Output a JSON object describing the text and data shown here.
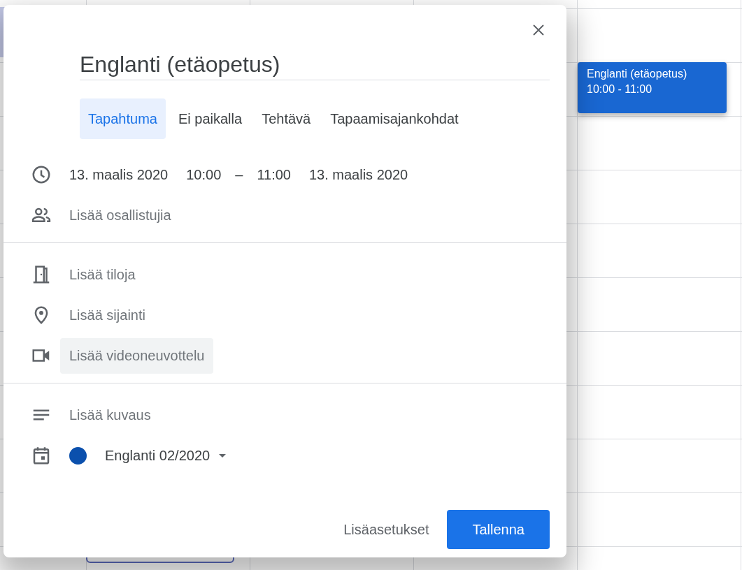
{
  "dialog": {
    "title": "Englanti (etäopetus)",
    "tabs": [
      {
        "label": "Tapahtuma",
        "selected": true
      },
      {
        "label": "Ei paikalla",
        "selected": false
      },
      {
        "label": "Tehtävä",
        "selected": false
      },
      {
        "label": "Tapaamisajankohdat",
        "selected": false
      }
    ],
    "date_time": {
      "start_date": "13. maalis 2020",
      "start_time": "10:00",
      "separator": "–",
      "end_time": "11:00",
      "end_date": "13. maalis 2020"
    },
    "sections": [
      [
        {
          "kind": "guests",
          "text": "Lisää osallistujia",
          "hovered": false
        }
      ],
      [
        {
          "kind": "rooms",
          "text": "Lisää tiloja",
          "hovered": false
        },
        {
          "kind": "location",
          "text": "Lisää sijainti",
          "hovered": false
        },
        {
          "kind": "video",
          "text": "Lisää videoneuvottelu",
          "hovered": true
        }
      ],
      [
        {
          "kind": "description",
          "text": "Lisää kuvaus",
          "hovered": false
        }
      ]
    ],
    "calendar": {
      "name": "Englanti 02/2020",
      "color": "#0b50ad"
    },
    "buttons": [
      {
        "kind": "text",
        "label": "Lisäasetukset"
      },
      {
        "kind": "primary",
        "label": "Tallenna"
      }
    ]
  },
  "event_chip": {
    "title": "Englanti (etäopetus)",
    "time": "10:00 - 11:00"
  }
}
